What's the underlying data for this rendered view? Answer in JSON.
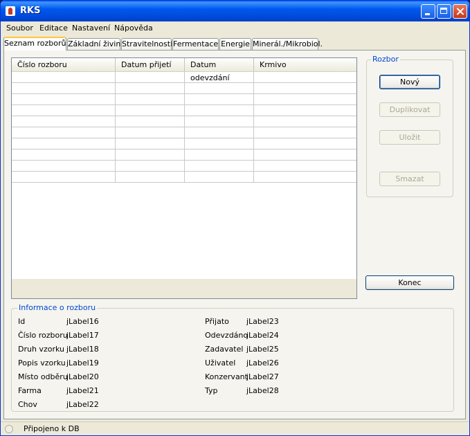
{
  "window": {
    "title": "RKS"
  },
  "menu": [
    "Soubor",
    "Editace",
    "Nastavení",
    "Nápověda"
  ],
  "tabs": [
    "Seznam rozborů",
    "Základní živiny",
    "Stravitelnosti",
    "Fermentace",
    "Energie",
    "Minerál./Mikrobiol."
  ],
  "active_tab": "Seznam rozborů",
  "table": {
    "columns": [
      "Číslo rozboru",
      "Datum přijetí",
      "Datum odevzdání",
      "Krmivo"
    ],
    "rows": [
      [
        "",
        "",
        "",
        ""
      ],
      [
        "",
        "",
        "",
        ""
      ],
      [
        "",
        "",
        "",
        ""
      ],
      [
        "",
        "",
        "",
        ""
      ],
      [
        "",
        "",
        "",
        ""
      ],
      [
        "",
        "",
        "",
        ""
      ],
      [
        "",
        "",
        "",
        ""
      ],
      [
        "",
        "",
        "",
        ""
      ],
      [
        "",
        "",
        "",
        ""
      ],
      [
        "",
        "",
        "",
        ""
      ]
    ]
  },
  "rozbor_group": {
    "title": "Rozbor",
    "buttons": {
      "new": "Nový",
      "duplicate": "Duplikovat",
      "save": "Uložit",
      "delete": "Smazat"
    }
  },
  "end_button": "Konec",
  "info": {
    "title": "Informace o rozboru",
    "left": [
      {
        "label": "Id",
        "value": "jLabel16"
      },
      {
        "label": "Číslo rozboru",
        "value": "jLabel17"
      },
      {
        "label": "Druh vzorku",
        "value": "jLabel18"
      },
      {
        "label": "Popis vzorku",
        "value": "jLabel19"
      },
      {
        "label": "Místo odběru",
        "value": "jLabel20"
      },
      {
        "label": "Farma",
        "value": "jLabel21"
      },
      {
        "label": "Chov",
        "value": "jLabel22"
      }
    ],
    "right": [
      {
        "label": "Přijato",
        "value": "jLabel23"
      },
      {
        "label": "Odevzdáno",
        "value": "jLabel24"
      },
      {
        "label": "Zadavatel",
        "value": "jLabel25"
      },
      {
        "label": "Uživatel",
        "value": "jLabel26"
      },
      {
        "label": "Konzervant",
        "value": "jLabel27"
      },
      {
        "label": "Typ",
        "value": "jLabel28"
      }
    ]
  },
  "status": {
    "text": "Připojeno k DB"
  }
}
